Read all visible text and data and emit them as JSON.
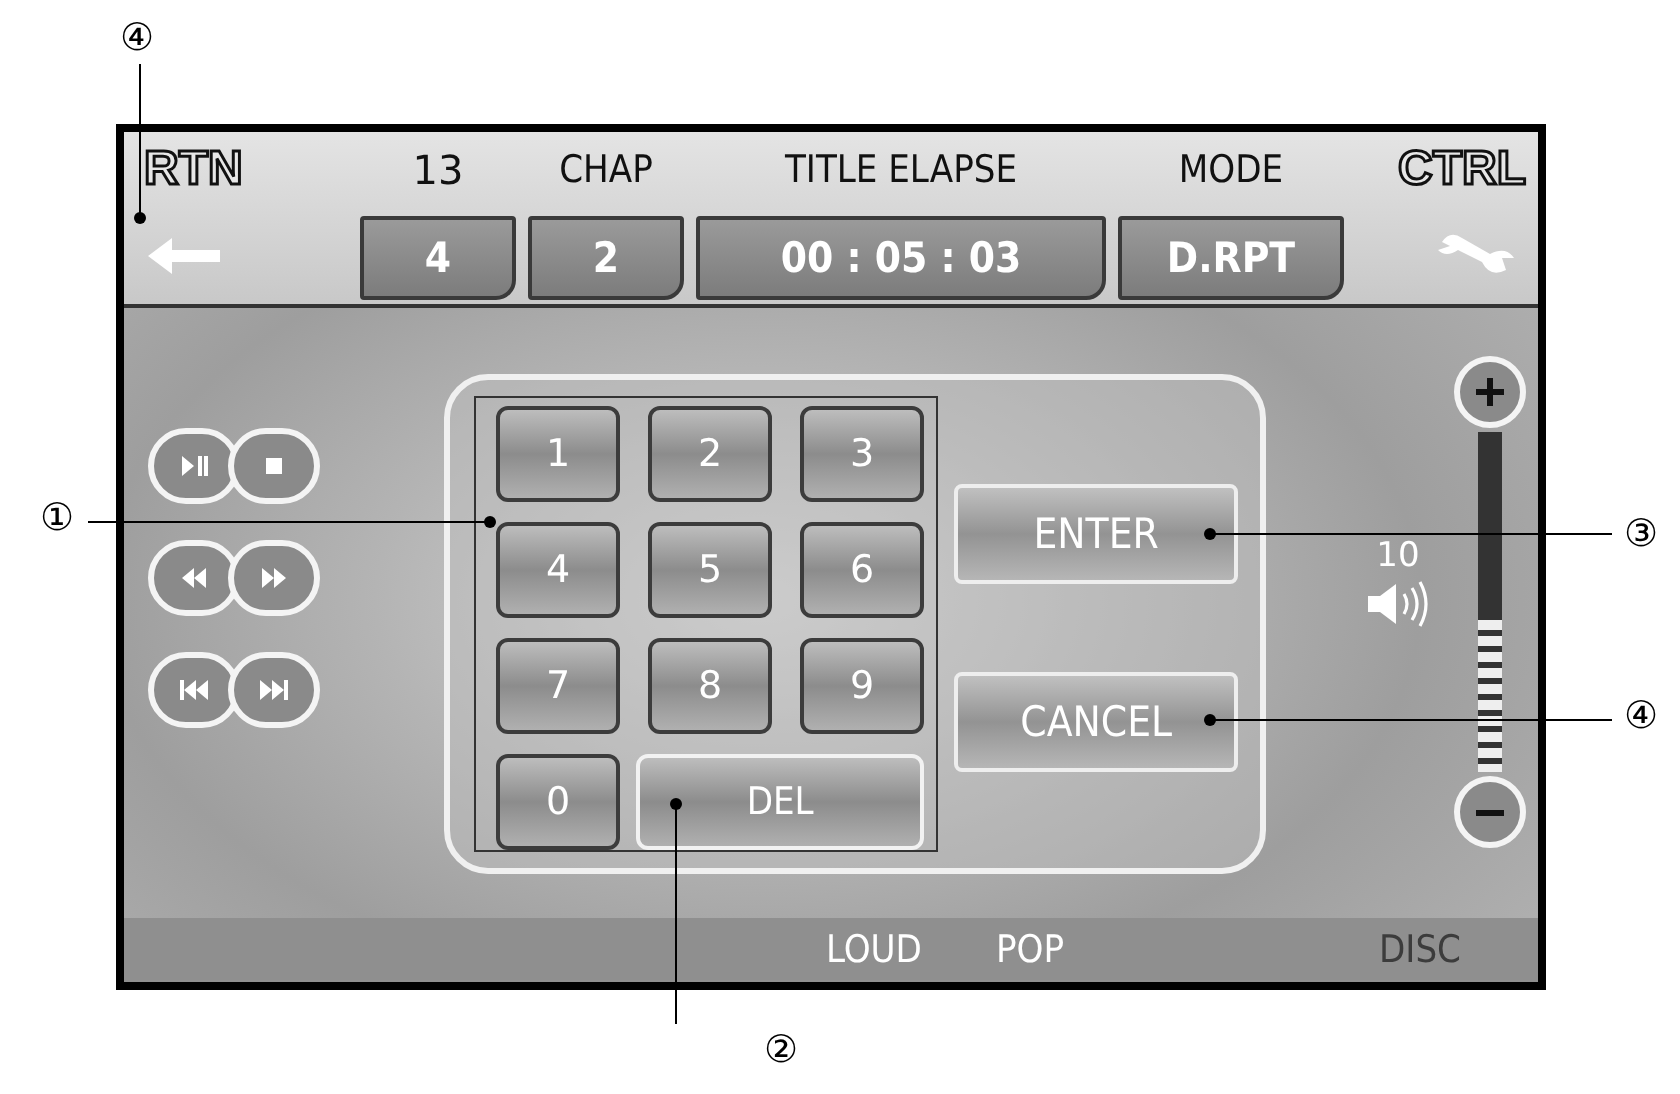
{
  "callouts": [
    {
      "label": "④"
    },
    {
      "label": "①"
    },
    {
      "label": "②"
    },
    {
      "label": "③"
    },
    {
      "label": "④"
    }
  ],
  "header": {
    "return_label": "RTN",
    "control_label": "CTRL",
    "labels": [
      "13",
      "CHAP",
      "TITLE ELAPSE",
      "MODE"
    ],
    "fields": [
      "4",
      "2",
      "00 : 05 : 03",
      "D.RPT"
    ]
  },
  "keypad": {
    "keys": [
      "1",
      "2",
      "3",
      "4",
      "5",
      "6",
      "7",
      "8",
      "9",
      "0"
    ],
    "delete": "DEL"
  },
  "actions": [
    "ENTER",
    "CANCEL"
  ],
  "volume": {
    "reading": "10",
    "level": 0.45
  },
  "status_bar": [
    {
      "label": "LOUD",
      "on": true
    },
    {
      "label": "POP",
      "on": true
    },
    {
      "label": "DISC",
      "on": false
    }
  ]
}
